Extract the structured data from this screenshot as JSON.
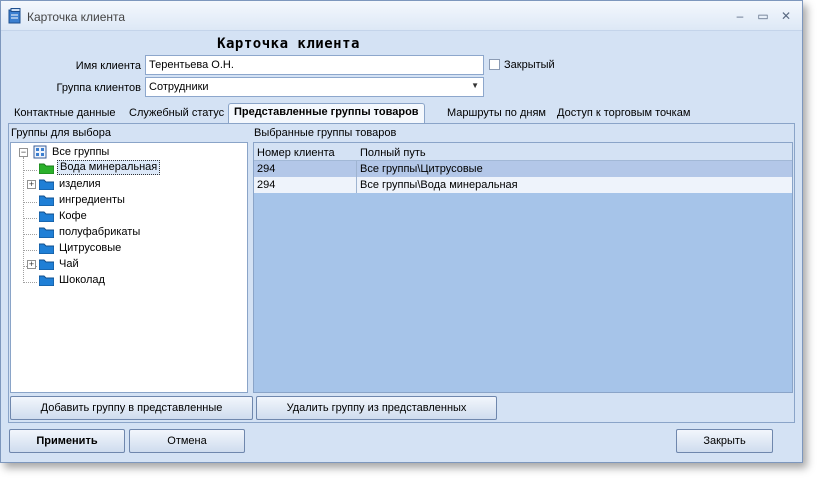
{
  "window": {
    "title": "Карточка клиента",
    "controls": [
      "–",
      "▭",
      "✕"
    ]
  },
  "heading": "Карточка клиента",
  "client_name": {
    "label": "Имя клиента",
    "value": "Терентьева О.Н."
  },
  "client_group": {
    "label": "Группа клиентов",
    "value": "Сотрудники"
  },
  "closed_checkbox": {
    "label": "Закрытый",
    "checked": false
  },
  "tabs": [
    {
      "label": "Контактные данные",
      "active": false
    },
    {
      "label": "Служебный статус",
      "active": false
    },
    {
      "label": "Представленные группы товаров",
      "active": true
    },
    {
      "label": "Маршруты по дням",
      "active": false
    },
    {
      "label": "Доступ к торговым точкам",
      "active": false
    }
  ],
  "left_panel": {
    "header": "Группы для выбора",
    "root": "Все группы",
    "items": [
      {
        "label": "Вода минеральная",
        "selected": true,
        "expandable": false,
        "color": "#2bb02b"
      },
      {
        "label": "изделия",
        "selected": false,
        "expandable": true,
        "color": "#1f7fd6"
      },
      {
        "label": "ингредиенты",
        "selected": false,
        "expandable": false,
        "color": "#1f7fd6"
      },
      {
        "label": "Кофе",
        "selected": false,
        "expandable": false,
        "color": "#1f7fd6"
      },
      {
        "label": "полуфабрикаты",
        "selected": false,
        "expandable": false,
        "color": "#1f7fd6"
      },
      {
        "label": "Цитрусовые",
        "selected": false,
        "expandable": false,
        "color": "#1f7fd6"
      },
      {
        "label": "Чай",
        "selected": false,
        "expandable": true,
        "color": "#1f7fd6"
      },
      {
        "label": "Шоколад",
        "selected": false,
        "expandable": false,
        "color": "#1f7fd6"
      }
    ]
  },
  "right_panel": {
    "header": "Выбранные группы товаров",
    "columns": [
      "Номер клиента",
      "Полный путь"
    ],
    "rows": [
      {
        "client_no": "294",
        "path": "Все группы\\Цитрусовые"
      },
      {
        "client_no": "294",
        "path": "Все группы\\Вода минеральная"
      }
    ]
  },
  "buttons": {
    "add_group": "Добавить группу в представленные",
    "remove_group": "Удалить группу из представленных",
    "apply": "Применить",
    "cancel": "Отмена",
    "close": "Закрыть"
  },
  "colors": {
    "window_bg": "#d4e2f4",
    "grid_bg": "#a6c4e9",
    "row_selected": "#b3c7e8",
    "row_alt": "#eef3fb"
  }
}
